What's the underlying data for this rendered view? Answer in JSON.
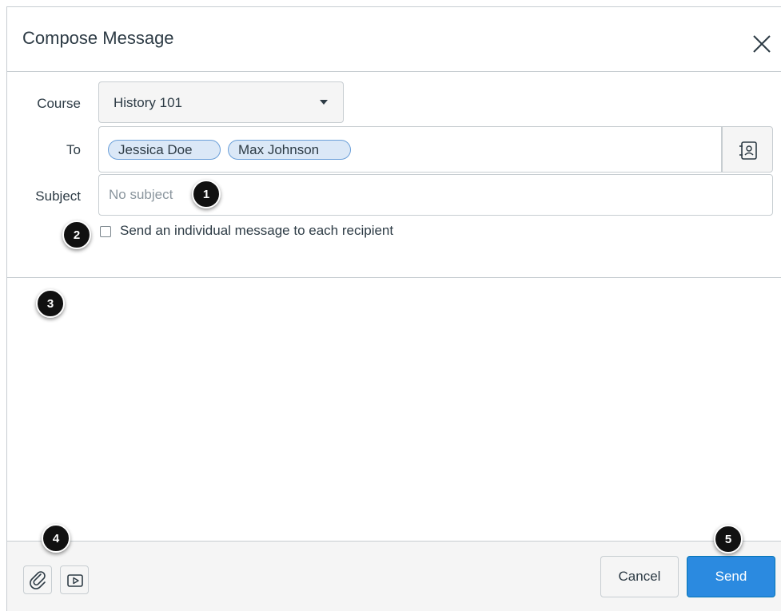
{
  "dialog": {
    "title": "Compose Message"
  },
  "form": {
    "course_label": "Course",
    "course_value": "History 101",
    "to_label": "To",
    "recipients": [
      "Jessica Doe",
      "Max Johnson"
    ],
    "subject_label": "Subject",
    "subject_placeholder": "No subject",
    "individual_label": "Send an individual message to each recipient",
    "individual_checked": false
  },
  "footer": {
    "cancel_label": "Cancel",
    "send_label": "Send"
  },
  "callouts": [
    "1",
    "2",
    "3",
    "4",
    "5"
  ],
  "icons": {
    "close": "close-icon",
    "address_book": "address-book-icon",
    "attach": "paperclip-icon",
    "media": "media-icon"
  },
  "colors": {
    "accent": "#2b8ae0",
    "token_bg": "#dbe8f7",
    "token_border": "#6a9fd9",
    "text": "#2d3b45",
    "border": "#c7cdd1",
    "footer_bg": "#f5f5f5"
  }
}
